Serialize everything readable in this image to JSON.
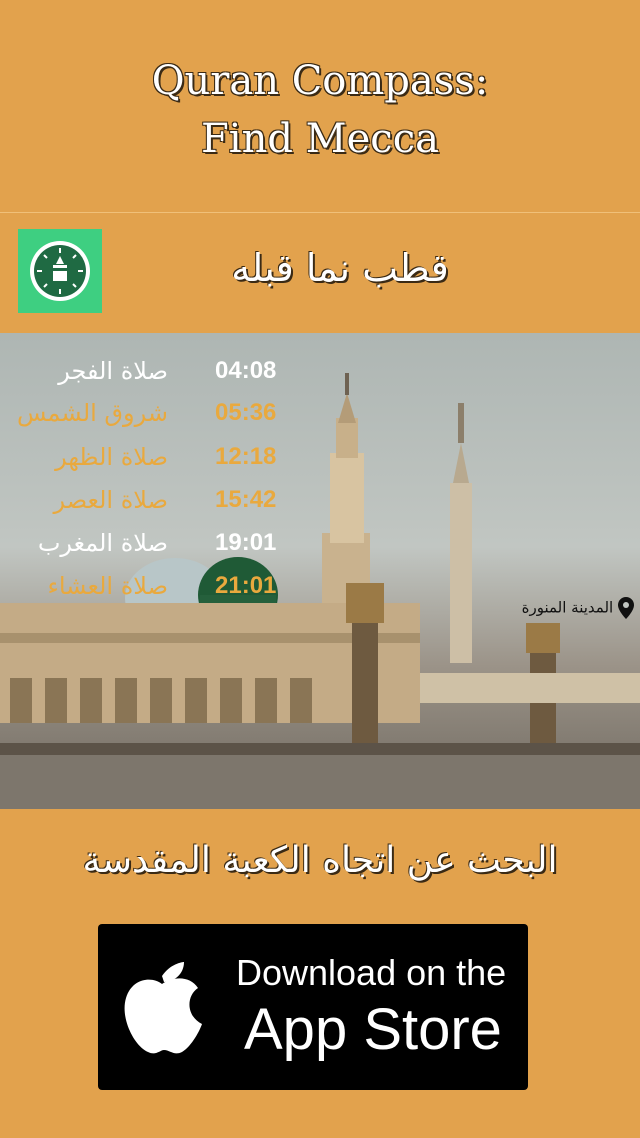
{
  "header": {
    "title_line1": "Quran Compass:",
    "title_line2": "Find Mecca"
  },
  "app": {
    "name": "قطب نما قبله",
    "icon": "compass-kaaba-icon",
    "icon_color": "#3ecf81"
  },
  "prayers": [
    {
      "name": "صلاة الفجر",
      "time": "04:08",
      "highlight": false
    },
    {
      "name": "شروق الشمس",
      "time": "05:36",
      "highlight": true
    },
    {
      "name": "صلاة الظهر",
      "time": "12:18",
      "highlight": true
    },
    {
      "name": "صلاة العصر",
      "time": "15:42",
      "highlight": true
    },
    {
      "name": "صلاة المغرب",
      "time": "19:01",
      "highlight": false
    },
    {
      "name": "صلاة العشاء",
      "time": "21:01",
      "highlight": true
    }
  ],
  "location": {
    "label": "المدينة المنورة",
    "icon": "map-pin-icon"
  },
  "search": {
    "text": "البحث عن اتجاه الكعبة المقدسة"
  },
  "store_badge": {
    "line1": "Download on the",
    "line2": "App Store",
    "icon": "apple-logo-icon"
  },
  "colors": {
    "background": "#E2A24D",
    "highlight": "#E9A93E"
  }
}
